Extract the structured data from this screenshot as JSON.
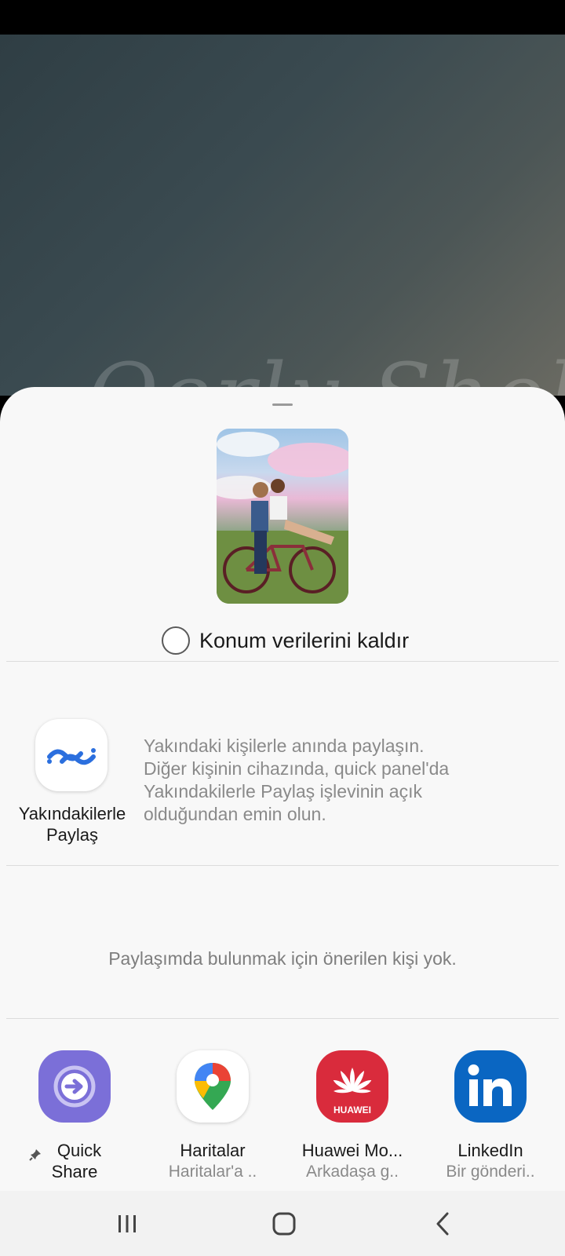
{
  "share_sheet": {
    "remove_location_label": "Konum verilerini kaldır",
    "nearby_share": {
      "label_line1": "Yakındakilerle",
      "label_line2": "Paylaş",
      "description_lines": [
        "Yakındaki kişilerle anında paylaşın.",
        "Diğer kişinin cihazında, quick panel'da",
        "Yakındakilerle Paylaş işlevinin açık",
        "olduğundan emin olun."
      ],
      "icon": "nearby-share-icon"
    },
    "no_suggestions_text": "Paylaşımda bulunmak için önerilen kişi yok.",
    "apps": [
      {
        "name_line1": "Quick",
        "name_line2": "Share",
        "icon": "quick-share-icon",
        "pinned": true,
        "color": "#7b6fd8"
      },
      {
        "name_line1": "Haritalar",
        "sub": "Haritalar'a ..",
        "icon": "google-maps-icon",
        "pinned": false,
        "color": "#ffffff"
      },
      {
        "name_line1": "Huawei Mo...",
        "sub": "Arkadaşa g..",
        "icon": "huawei-icon",
        "pinned": false,
        "color": "#d92b3c"
      },
      {
        "name_line1": "LinkedIn",
        "sub": "Bir gönderi..",
        "icon": "linkedin-icon",
        "pinned": false,
        "color": "#0a66c2"
      }
    ]
  },
  "nav_bar": {
    "recents": "recents-icon",
    "home": "home-icon",
    "back": "back-icon"
  }
}
